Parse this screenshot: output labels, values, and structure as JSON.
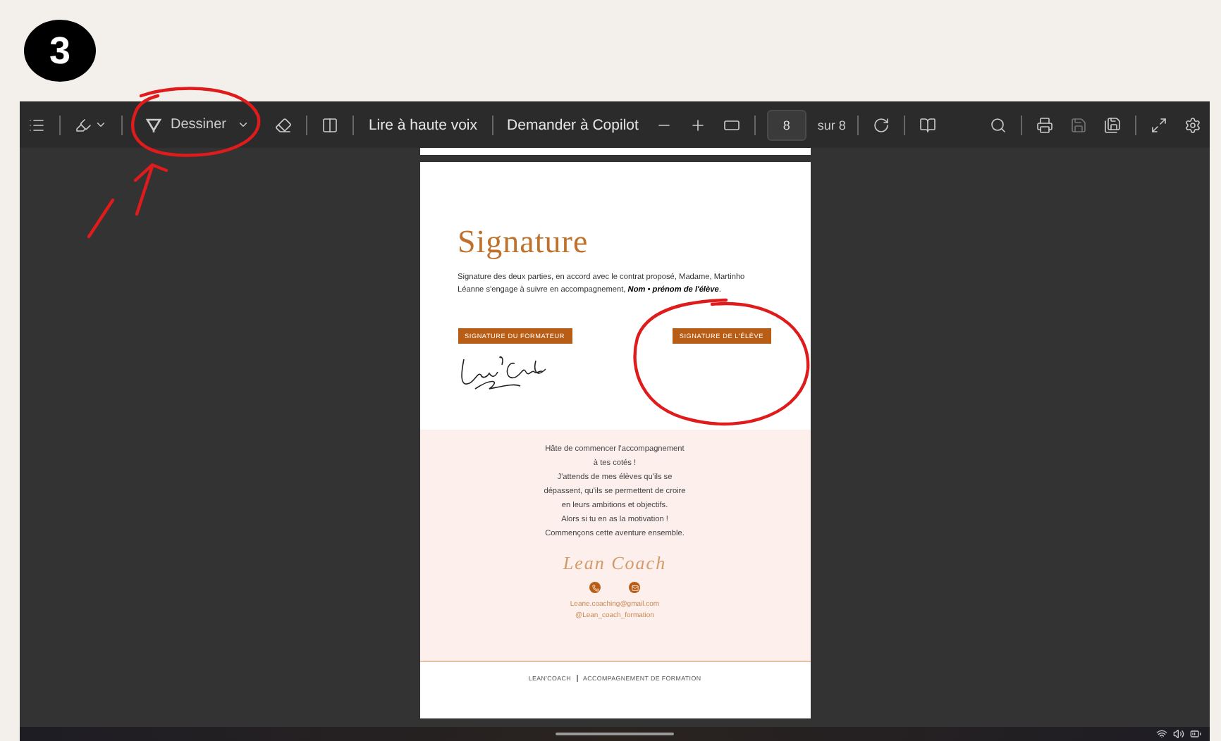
{
  "step_badge": "3",
  "toolbar": {
    "draw_label": "Dessiner",
    "read_aloud": "Lire à haute voix",
    "copilot": "Demander à Copilot",
    "page_number": "8",
    "page_total": "sur 8"
  },
  "document": {
    "title": "Signature",
    "intro": "Signature des deux parties, en accord avec le contrat proposé, Madame, Martinho Léanne s'engage à suivre en accompagnement, **Nom • prénom de l'élève**.",
    "signature_labels": [
      {
        "label": "SIGNATURE DU FORMATEUR",
        "signed": true
      },
      {
        "label": "SIGNATURE DE L'ÉLÈVE",
        "signed": false
      }
    ],
    "message_lines": [
      "Hâte de commencer l'accompagnement",
      "à tes cotés !",
      "J'attends de mes élèves qu'ils se",
      "dépassent, qu'ils se permettent de croire",
      "en leurs ambitions et objectifs.",
      "Alors si tu en as la motivation !",
      "Commençons cette aventure ensemble."
    ],
    "brand_script": "Lean Coach",
    "contacts": [
      "Leane.coaching@gmail.com",
      "@Lean_coach_formation"
    ],
    "footer": [
      "LEAN'COACH",
      "ACCOMPAGNEMENT DE FORMATION"
    ]
  }
}
